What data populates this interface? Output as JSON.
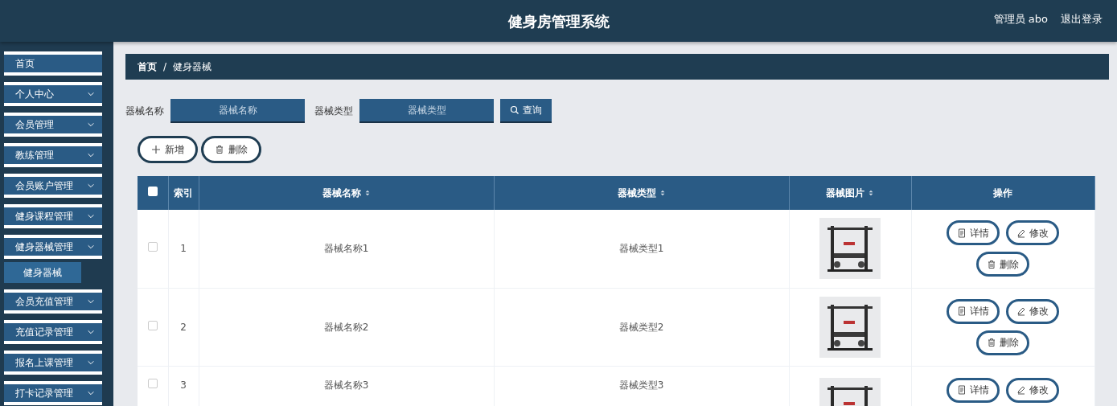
{
  "header": {
    "title": "健身房管理系统",
    "user": "管理员 abo",
    "logout": "退出登录"
  },
  "sidebar": {
    "items": [
      {
        "label": "首页",
        "expandable": false,
        "selected": false
      },
      {
        "label": "个人中心",
        "expandable": true,
        "selected": false
      },
      {
        "label": "会员管理",
        "expandable": true,
        "selected": false
      },
      {
        "label": "教练管理",
        "expandable": true,
        "selected": false
      },
      {
        "label": "会员账户管理",
        "expandable": true,
        "selected": false
      },
      {
        "label": "健身课程管理",
        "expandable": true,
        "selected": false
      },
      {
        "label": "健身器械管理",
        "expandable": true,
        "selected": false,
        "children": [
          {
            "label": "健身器械",
            "selected": true
          }
        ]
      },
      {
        "label": "会员充值管理",
        "expandable": true,
        "selected": false
      },
      {
        "label": "充值记录管理",
        "expandable": true,
        "selected": false
      },
      {
        "label": "报名上课管理",
        "expandable": true,
        "selected": false
      },
      {
        "label": "打卡记录管理",
        "expandable": true,
        "selected": false
      }
    ]
  },
  "breadcrumb": {
    "separator": "/",
    "items": [
      "首页",
      "健身器械"
    ]
  },
  "search": {
    "fields": [
      {
        "label": "器械名称",
        "placeholder": "器械名称"
      },
      {
        "label": "器械类型",
        "placeholder": "器械类型"
      }
    ],
    "button": "查询"
  },
  "toolbar": [
    {
      "kind": "add",
      "label": "新增"
    },
    {
      "kind": "delete",
      "label": "删除"
    }
  ],
  "table": {
    "select_all_checked": false,
    "columns": [
      {
        "kind": "check"
      },
      {
        "kind": "text",
        "label": "索引",
        "sortable": false
      },
      {
        "kind": "text",
        "label": "器械名称",
        "sortable": true
      },
      {
        "kind": "text",
        "label": "器械类型",
        "sortable": true
      },
      {
        "kind": "text",
        "label": "器械图片",
        "sortable": true
      },
      {
        "kind": "text",
        "label": "操作",
        "sortable": false
      }
    ],
    "rows": [
      {
        "checked": false,
        "index": "1",
        "name": "器械名称1",
        "type": "器械类型1",
        "image": {
          "kind": "picture"
        },
        "actions": [
          {
            "kind": "detail",
            "label": "详情"
          },
          {
            "kind": "edit",
            "label": "修改"
          },
          {
            "kind": "delete",
            "label": "删除"
          }
        ]
      },
      {
        "checked": false,
        "index": "2",
        "name": "器械名称2",
        "type": "器械类型2",
        "image": {
          "kind": "picture"
        },
        "actions": [
          {
            "kind": "detail",
            "label": "详情"
          },
          {
            "kind": "edit",
            "label": "修改"
          },
          {
            "kind": "delete",
            "label": "删除"
          }
        ]
      },
      {
        "checked": false,
        "index": "3",
        "name": "器械名称3",
        "type": "器械类型3",
        "image": {
          "kind": "picture"
        },
        "actions": [
          {
            "kind": "detail",
            "label": "详情"
          },
          {
            "kind": "edit",
            "label": "修改"
          }
        ]
      }
    ]
  }
}
